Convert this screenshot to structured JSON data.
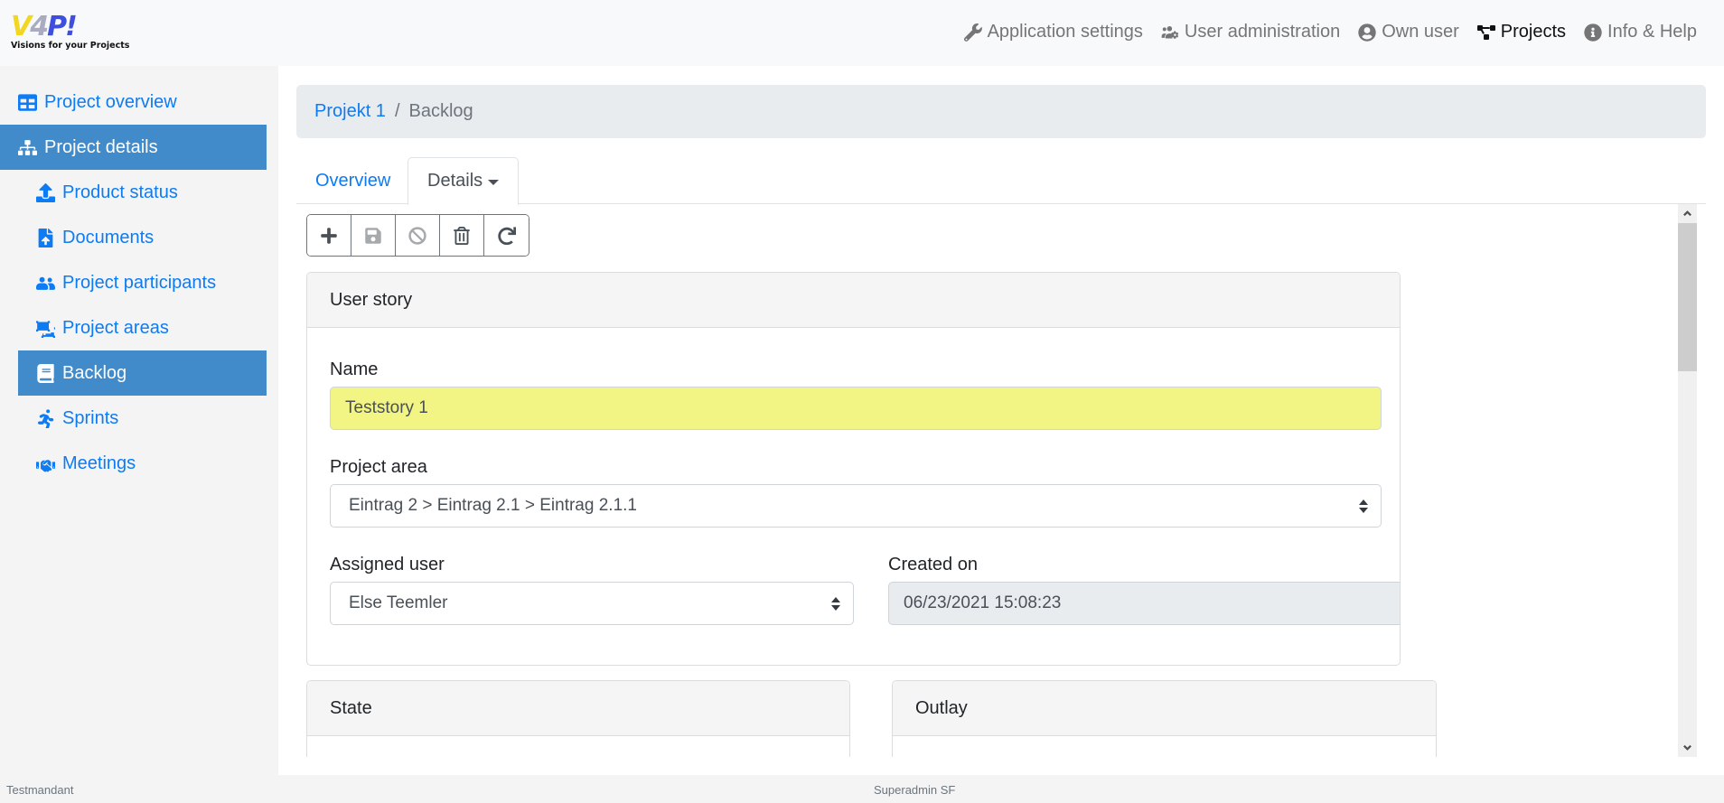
{
  "app": {
    "logo_main": "V4P!",
    "logo_tagline": "Visions for your Projects"
  },
  "topnav": [
    {
      "label": "Application settings",
      "icon": "wrench-icon",
      "active": false
    },
    {
      "label": "User administration",
      "icon": "users-cog-icon",
      "active": false
    },
    {
      "label": "Own user",
      "icon": "user-circle-icon",
      "active": false
    },
    {
      "label": "Projects",
      "icon": "project-diagram-icon",
      "active": true
    },
    {
      "label": "Info & Help",
      "icon": "info-circle-icon",
      "active": false
    }
  ],
  "sidebar": {
    "items": [
      {
        "label": "Project overview",
        "icon": "table-grid-icon",
        "active": false
      },
      {
        "label": "Project details",
        "icon": "sitemap-icon",
        "active": true
      },
      {
        "label": "Product status",
        "icon": "upload-icon",
        "active": false
      },
      {
        "label": "Documents",
        "icon": "file-upload-icon",
        "active": false
      },
      {
        "label": "Project participants",
        "icon": "users-icon",
        "active": false
      },
      {
        "label": "Project areas",
        "icon": "object-ungroup-icon",
        "active": false
      },
      {
        "label": "Backlog",
        "icon": "book-icon",
        "active": true
      },
      {
        "label": "Sprints",
        "icon": "running-icon",
        "active": false
      },
      {
        "label": "Meetings",
        "icon": "handshake-icon",
        "active": false
      }
    ]
  },
  "breadcrumb": {
    "parent": "Projekt 1",
    "separator": "/",
    "current": "Backlog"
  },
  "tabs": [
    {
      "label": "Overview",
      "active": false
    },
    {
      "label": "Details",
      "active": true,
      "dropdown": true
    }
  ],
  "toolbar": {
    "buttons": [
      {
        "name": "add",
        "icon": "plus-icon",
        "enabled": true
      },
      {
        "name": "save",
        "icon": "save-icon",
        "enabled": false
      },
      {
        "name": "cancel",
        "icon": "ban-icon",
        "enabled": false
      },
      {
        "name": "delete",
        "icon": "trash-icon",
        "enabled": true
      },
      {
        "name": "reload",
        "icon": "redo-icon",
        "enabled": true
      }
    ]
  },
  "user_story": {
    "title": "User story",
    "name_label": "Name",
    "name_value": "Teststory 1",
    "project_area_label": "Project area",
    "project_area_value": "Eintrag 2 > Eintrag 2.1 > Eintrag 2.1.1",
    "assigned_user_label": "Assigned user",
    "assigned_user_value": "Else Teemler",
    "created_on_label": "Created on",
    "created_on_value": "06/23/2021 15:08:23"
  },
  "state_card": {
    "title": "State"
  },
  "outlay_card": {
    "title": "Outlay"
  },
  "footer": {
    "tenant": "Testmandant",
    "user": "Superadmin SF"
  },
  "colors": {
    "link": "#0d7bf3",
    "active_bg": "#428bca",
    "highlight_input": "#f2f583"
  }
}
